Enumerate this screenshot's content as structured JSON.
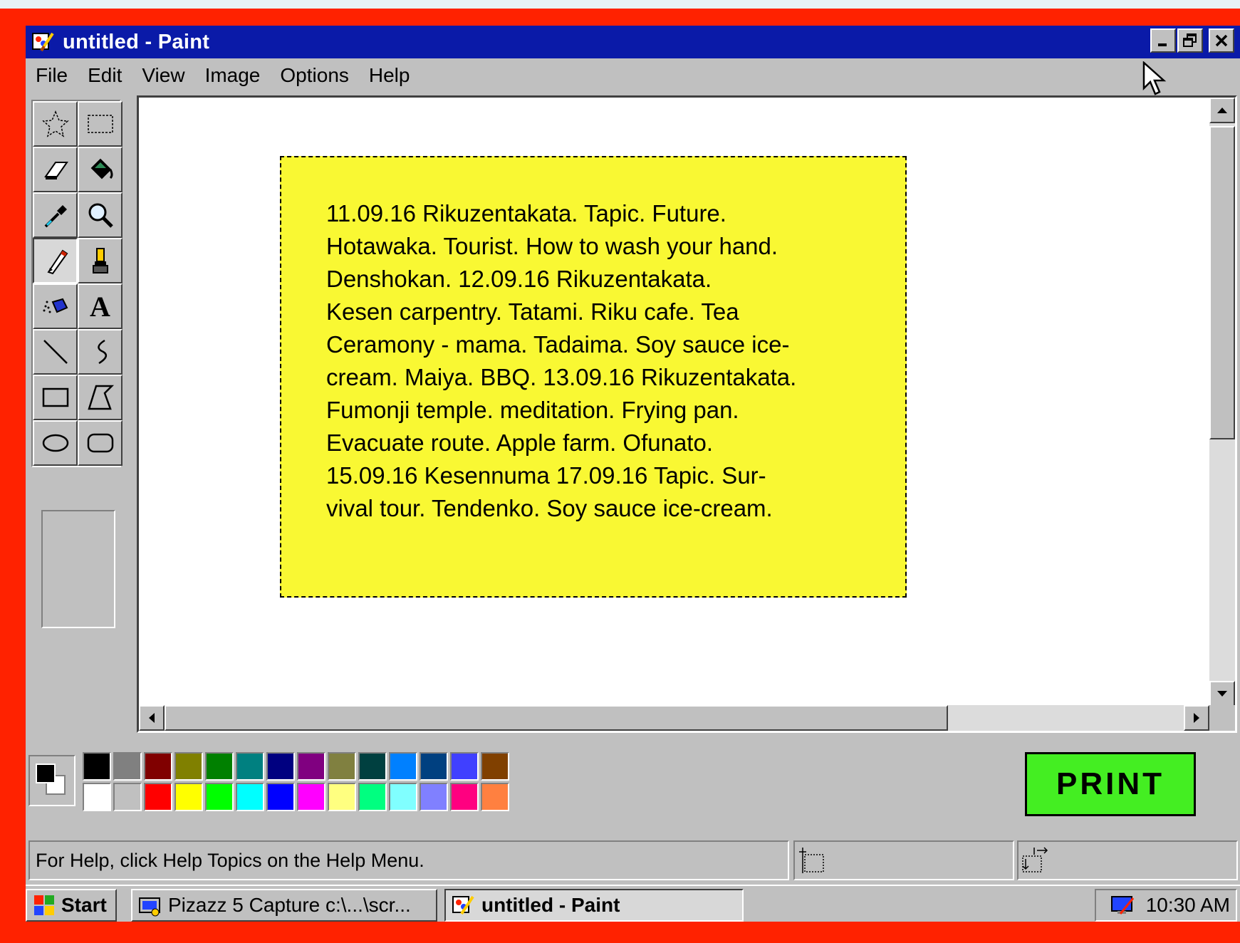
{
  "window": {
    "title": "untitled - Paint",
    "controls": {
      "minimize": "_",
      "restore": "❐",
      "close": "✕"
    }
  },
  "menu": [
    "File",
    "Edit",
    "View",
    "Image",
    "Options",
    "Help"
  ],
  "tools": [
    {
      "name": "free-form-select",
      "icon": "star-select-icon"
    },
    {
      "name": "rect-select",
      "icon": "rect-select-icon"
    },
    {
      "name": "eraser",
      "icon": "eraser-icon"
    },
    {
      "name": "fill",
      "icon": "paint-bucket-icon"
    },
    {
      "name": "pick-color",
      "icon": "eyedropper-icon"
    },
    {
      "name": "magnifier",
      "icon": "magnifier-icon"
    },
    {
      "name": "pencil",
      "icon": "pencil-icon",
      "active": true
    },
    {
      "name": "brush",
      "icon": "brush-icon"
    },
    {
      "name": "airbrush",
      "icon": "airbrush-icon"
    },
    {
      "name": "text",
      "icon": "text-icon",
      "glyph": "A"
    },
    {
      "name": "line",
      "icon": "line-icon"
    },
    {
      "name": "curve",
      "icon": "curve-icon"
    },
    {
      "name": "rectangle",
      "icon": "rectangle-icon"
    },
    {
      "name": "polygon",
      "icon": "polygon-icon"
    },
    {
      "name": "ellipse",
      "icon": "ellipse-icon"
    },
    {
      "name": "rounded-rect",
      "icon": "rounded-rect-icon"
    }
  ],
  "canvas": {
    "note_text": "11.09.16 Rikuzentakata. Tapic. Future.\nHotawaka. Tourist. How to wash your hand.\nDenshokan. 12.09.16 Rikuzentakata.\nKesen carpentry. Tatami. Riku cafe. Tea\nCeramony - mama. Tadaima. Soy sauce ice-\ncream. Maiya. BBQ. 13.09.16 Rikuzentakata.\nFumonji temple. meditation. Frying pan.\nEvacuate route. Apple farm. Ofunato.\n15.09.16 Kesennuma 17.09.16 Tapic. Sur-\nvival tour. Tendenko. Soy sauce ice-cream.",
    "note_color": "#f9f833"
  },
  "palette": {
    "foreground": "#000000",
    "background": "#ffffff",
    "top_row": [
      "#000000",
      "#808080",
      "#800000",
      "#808000",
      "#008000",
      "#008080",
      "#000080",
      "#800080",
      "#808040",
      "#004040",
      "#0080ff",
      "#004080",
      "#4040ff",
      "#804000"
    ],
    "bottom_row": [
      "#ffffff",
      "#c0c0c0",
      "#ff0000",
      "#ffff00",
      "#00ff00",
      "#00ffff",
      "#0000ff",
      "#ff00ff",
      "#ffff80",
      "#00ff80",
      "#80ffff",
      "#8080ff",
      "#ff0080",
      "#ff8040"
    ]
  },
  "print_button": {
    "label": "PRINT",
    "color": "#44ee22"
  },
  "status": {
    "message": "For Help, click Help Topics on the Help Menu."
  },
  "taskbar": {
    "start_label": "Start",
    "tasks": [
      "Pizazz 5 Capture c:\\...\\scr...",
      "untitled - Paint"
    ],
    "clock": "10:30 AM"
  }
}
